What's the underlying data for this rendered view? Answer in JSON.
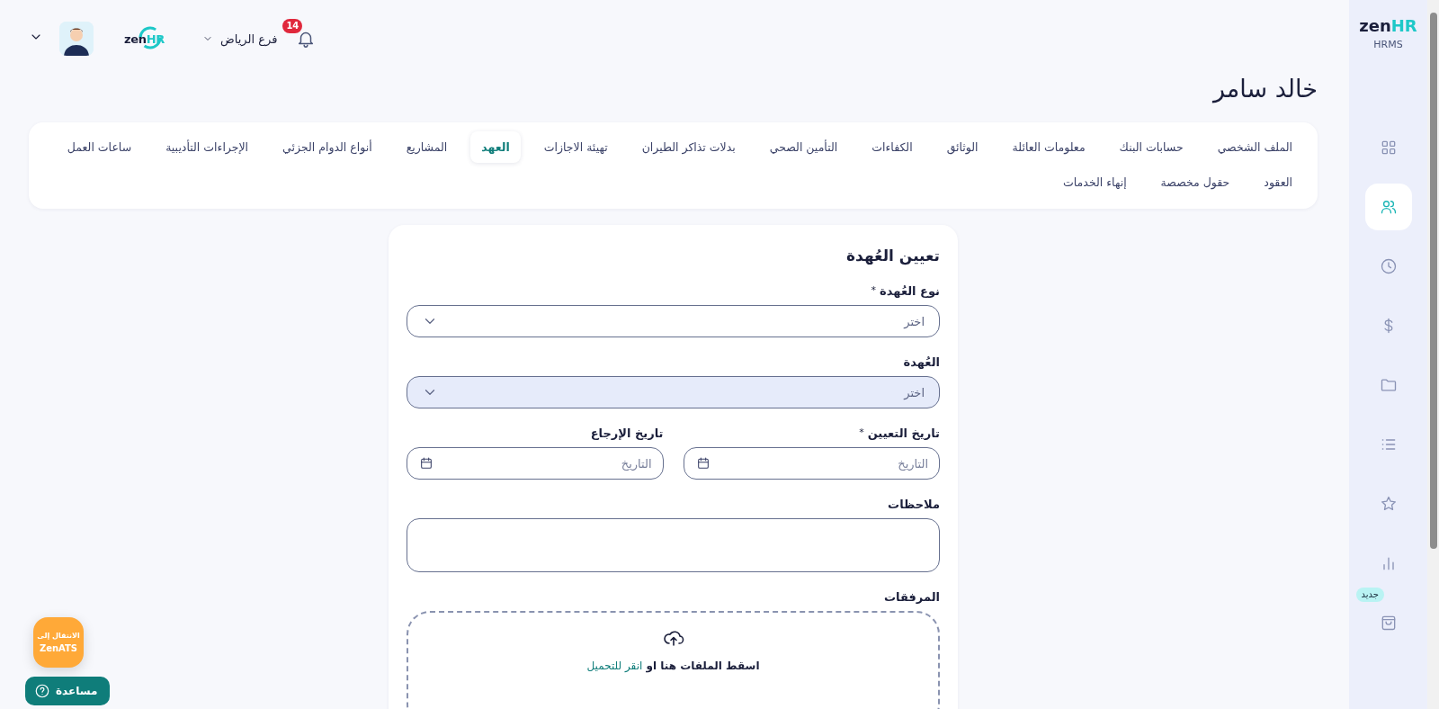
{
  "topbar": {
    "notifications": {
      "count": "14"
    },
    "branch": "فرع الرياض",
    "logo": {
      "zen": "zen",
      "hr": "HR"
    }
  },
  "sidebar": {
    "logo": {
      "zen": "zen",
      "hr": "HR",
      "sub": "HRMS"
    },
    "items": [
      {
        "selected": false
      },
      {
        "selected": true
      },
      {
        "selected": false
      },
      {
        "selected": false
      },
      {
        "selected": false
      },
      {
        "selected": false
      },
      {
        "selected": false
      },
      {
        "selected": false
      },
      {
        "selected": false,
        "badge": "جديد"
      }
    ]
  },
  "page_title": "خالد سامر",
  "tabs": [
    {
      "label": "الملف الشخصي",
      "selected": false
    },
    {
      "label": "حسابات البنك",
      "selected": false
    },
    {
      "label": "معلومات العائلة",
      "selected": false
    },
    {
      "label": "الوثائق",
      "selected": false
    },
    {
      "label": "الكفاءات",
      "selected": false
    },
    {
      "label": "التأمين الصحي",
      "selected": false
    },
    {
      "label": "بدلات تذاكر الطيران",
      "selected": false
    },
    {
      "label": "تهيئة الاجازات",
      "selected": false
    },
    {
      "label": "العهد",
      "selected": true
    },
    {
      "label": "المشاريع",
      "selected": false
    },
    {
      "label": "أنواع الدوام الجزئي",
      "selected": false
    },
    {
      "label": "الإجراءات التأديبية",
      "selected": false
    },
    {
      "label": "ساعات العمل",
      "selected": false
    },
    {
      "label": "العقود",
      "selected": false
    },
    {
      "label": "حقول مخصصة",
      "selected": false
    },
    {
      "label": "إنهاء الخدمات",
      "selected": false
    }
  ],
  "form": {
    "title": "تعيين العُهدة",
    "fields": [
      {
        "kind": "select",
        "label": "نوع العُهدة",
        "required_mark": "*",
        "placeholder": "اختر",
        "disabled": false
      },
      {
        "kind": "select",
        "label": "العُهدة",
        "placeholder": "اختر",
        "disabled": true
      },
      {
        "kind": "date",
        "label": "تاريخ التعيين",
        "required_mark": "*",
        "placeholder": "التاريخ"
      },
      {
        "kind": "date",
        "label": "تاريخ الإرجاع",
        "placeholder": "التاريخ"
      },
      {
        "kind": "textarea",
        "label": "ملاحظات"
      },
      {
        "kind": "upload",
        "label": "المرفقات",
        "text": "اسقط الملفات هنا او",
        "link": "انقر للتحميل"
      }
    ]
  },
  "floating": {
    "ats": {
      "line1": "الانتقال إلى",
      "line2": "ZenATS"
    },
    "help": "مساعدة"
  }
}
